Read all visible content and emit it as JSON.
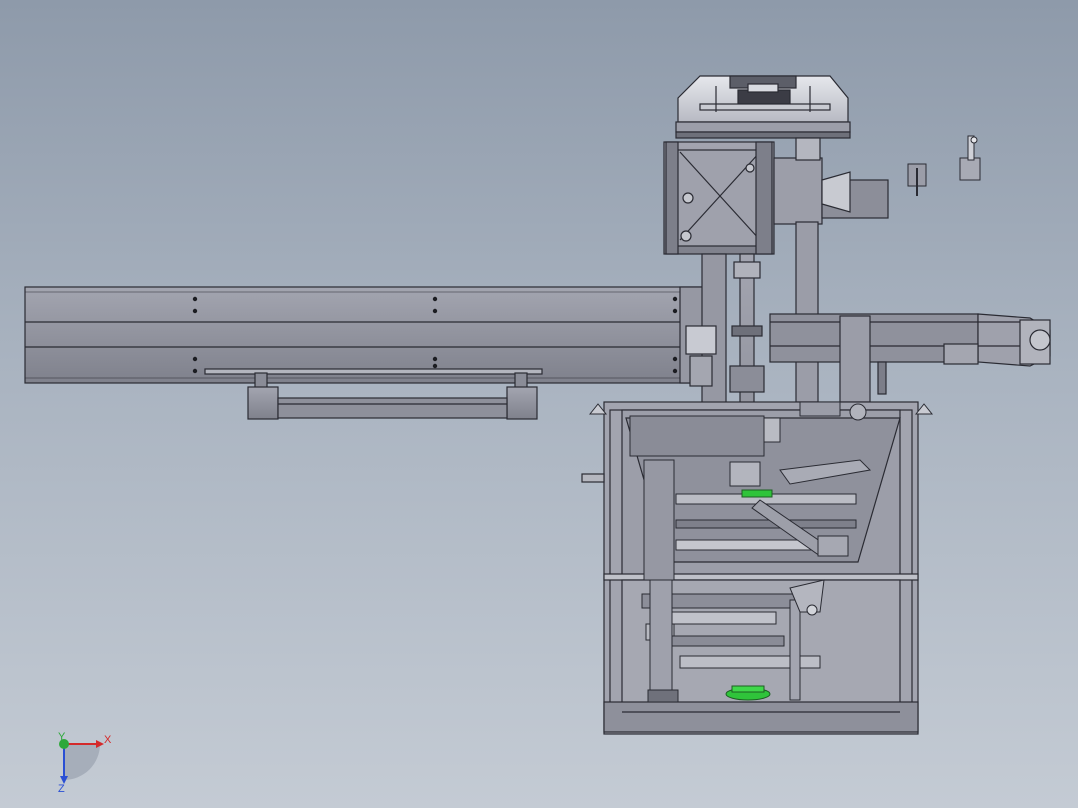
{
  "viewport": {
    "background_top": "#8e9aaa",
    "background_bottom": "#c4cbd4"
  },
  "model": {
    "body_color": "#8f919c",
    "edge_color": "#2a2b33",
    "highlight_color": "#cfd1d8",
    "accent_green": "#2fc43a"
  },
  "triad": {
    "x_label": "X",
    "y_label": "Y",
    "z_label": "Z",
    "x_color": "#d42a2a",
    "y_color": "#2ca83a",
    "z_color": "#2a4fd4"
  }
}
